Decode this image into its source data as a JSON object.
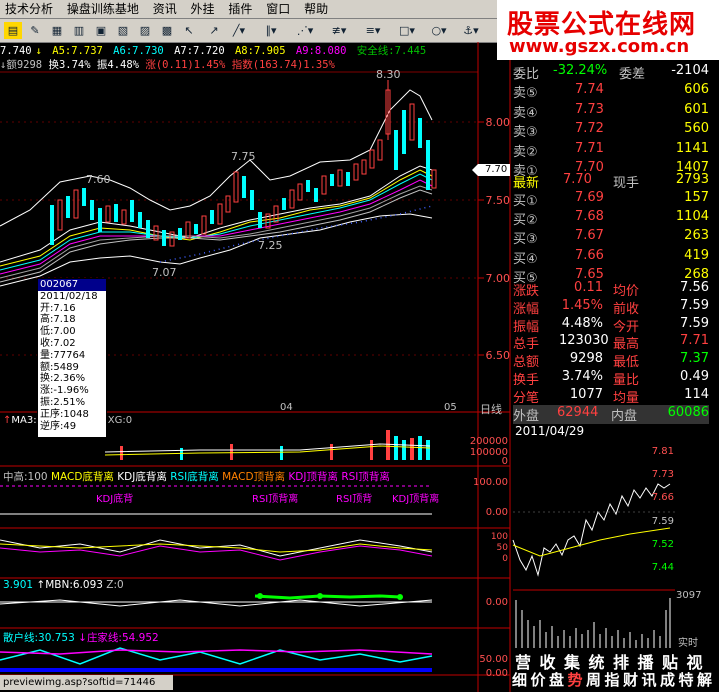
{
  "menu": [
    "技术分析",
    "操盘训练基地",
    "资讯",
    "外挂",
    "插件",
    "窗口",
    "帮助"
  ],
  "brand": {
    "title": "股票公式在线网",
    "url": "www.gszx.com.cn"
  },
  "ma_line": [
    "7.740",
    "A5:7.737",
    "A6:7.730",
    "A7:7.720",
    "A8:7.905",
    "A9:8.080",
    "安全线:7.445"
  ],
  "row2": {
    "amount": "额9298",
    "turnover": "换3.74%",
    "amplitude": "振4.48%",
    "change": "涨(0.11)1.45%",
    "index": "指数(163.74)1.35%"
  },
  "price_marks": {
    "high": "8.30",
    "p760": "7.60",
    "p775": "7.75",
    "p707": "7.07",
    "p725": "7.25"
  },
  "price_axis": [
    "8.00",
    "7.50",
    "7.00",
    "6.50"
  ],
  "current_price": "7.70",
  "date_axis": {
    "d1": "04",
    "d2": "05",
    "label": "日线"
  },
  "tooltip": [
    "002067",
    "2011/02/18",
    "开:7.16",
    "高:7.18",
    "低:7.00",
    "收:7.02",
    "量:77764",
    "额:5489",
    "换:2.36%",
    "涨:-1.96%",
    "振:2.51%",
    "正序:1048",
    "逆序:49"
  ],
  "vol_panel": {
    "label": "MA3:",
    "xg": "XG:0",
    "axis": [
      "200000",
      "100000",
      "0"
    ]
  },
  "div_panel": {
    "label": "中高:100",
    "items": [
      "MACD底背离",
      "KDJ底背离",
      "RSI底背离",
      "MACD顶背离",
      "KDJ顶背离",
      "RSI顶背离"
    ],
    "marks": [
      "KDJ底背",
      "RSI顶背离",
      "RSI顶背",
      "KDJ顶背离"
    ],
    "axis": [
      "100.00",
      "0.00"
    ]
  },
  "kd_panel": {
    "axis": [
      "100",
      "50",
      "0"
    ]
  },
  "mbn_panel": {
    "label": "3.901",
    "mbn": "MBN:6.093",
    "z": "Z:0",
    "axis": [
      "0.00"
    ]
  },
  "sanhu_panel": {
    "sanhu": "散户线:30.753",
    "zhuang": "庄家线:54.952",
    "axis": [
      "50.00",
      "0.00"
    ]
  },
  "quote": {
    "weibi": {
      "label": "委比",
      "value": "-32.24%",
      "label2": "委差",
      "value2": "-2104"
    },
    "sells": [
      {
        "label": "卖⑤",
        "price": "7.74",
        "vol": "606"
      },
      {
        "label": "卖④",
        "price": "7.73",
        "vol": "601"
      },
      {
        "label": "卖③",
        "price": "7.72",
        "vol": "560"
      },
      {
        "label": "卖②",
        "price": "7.71",
        "vol": "1141"
      },
      {
        "label": "卖①",
        "price": "7.70",
        "vol": "1407"
      }
    ],
    "latest": {
      "label": "最新",
      "price": "7.70",
      "label2": "现手",
      "vol": "2793"
    },
    "buys": [
      {
        "label": "买①",
        "price": "7.69",
        "vol": "157"
      },
      {
        "label": "买②",
        "price": "7.68",
        "vol": "1104"
      },
      {
        "label": "买③",
        "price": "7.67",
        "vol": "263"
      },
      {
        "label": "买④",
        "price": "7.66",
        "vol": "419"
      },
      {
        "label": "买⑤",
        "price": "7.65",
        "vol": "268"
      }
    ],
    "stats": [
      {
        "k1": "涨跌",
        "v1": "0.11",
        "k2": "均价",
        "v2": "7.56"
      },
      {
        "k1": "涨幅",
        "v1": "1.45%",
        "k2": "前收",
        "v2": "7.59"
      },
      {
        "k1": "振幅",
        "v1": "4.48%",
        "k2": "今开",
        "v2": "7.59"
      },
      {
        "k1": "总手",
        "v1": "123030",
        "k2": "最高",
        "v2": "7.71"
      },
      {
        "k1": "总额",
        "v1": "9298",
        "k2": "最低",
        "v2": "7.37"
      },
      {
        "k1": "换手",
        "v1": "3.74%",
        "k2": "量比",
        "v2": "0.49"
      },
      {
        "k1": "分笔",
        "v1": "1077",
        "k2": "均量",
        "v2": "114"
      }
    ],
    "outer": {
      "label": "外盘",
      "value": "62944",
      "label2": "内盘",
      "value2": "60086"
    }
  },
  "intraday": {
    "date": "2011/04/29",
    "axis": [
      "7.81",
      "7.73",
      "7.66",
      "7.59",
      "7.52",
      "7.44"
    ],
    "vol_axis": "3097",
    "realtime": "实时"
  },
  "bottom_buttons": {
    "row1": [
      "营",
      "收",
      "集",
      "统",
      "排",
      "播",
      "贴",
      "视"
    ],
    "row2": [
      "细",
      "价",
      "盘",
      "势",
      "周",
      "指",
      "财",
      "讯",
      "成",
      "特",
      "解"
    ]
  },
  "status": "previewimg.asp?softid=71446"
}
